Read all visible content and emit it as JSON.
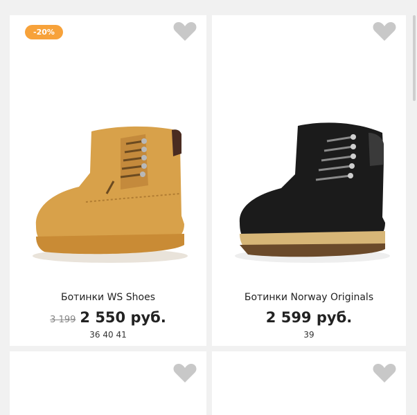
{
  "products": [
    {
      "badge": "-20%",
      "title": "Ботинки WS Shoes",
      "old_price": "3 199",
      "price": "2 550 руб.",
      "sizes": "36 40 41",
      "boot_color": "#d8a14a"
    },
    {
      "title": "Ботинки Norway Originals",
      "price": "2 599 руб.",
      "sizes": "39",
      "boot_color": "#1b1b1b"
    }
  ],
  "colors": {
    "badge": "#f7a23a",
    "heart": "#c8c8c8"
  },
  "icons": {
    "favorite": "heart-icon"
  }
}
